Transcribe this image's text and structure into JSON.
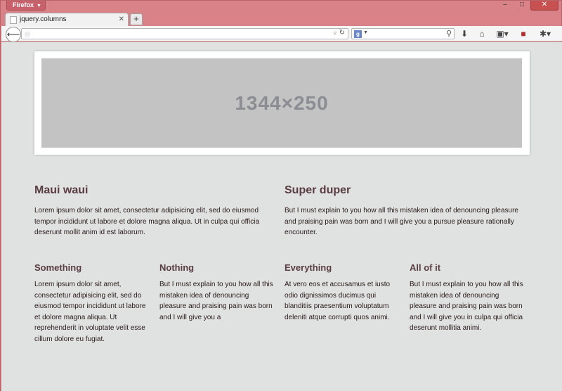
{
  "browser": {
    "app_button": "Firefox",
    "tab_title": "jquery.columns",
    "new_tab_label": "+",
    "url_value": "",
    "search_value": "",
    "controls": {
      "minimize": "–",
      "maximize": "□",
      "close": "✕"
    }
  },
  "banner": {
    "label": "1344×250"
  },
  "row1": [
    {
      "heading": "Maui waui",
      "text": "Lorem ipsum dolor sit amet, consectetur adipisicing elit, sed do eiusmod tempor incididunt ut labore et dolore magna aliqua. Ut in culpa qui officia deserunt mollit anim id est laborum."
    },
    {
      "heading": "Super duper",
      "text": "But I must explain to you how all this mistaken idea of denouncing pleasure and praising pain was born and I will give you a pursue pleasure rationally encounter."
    }
  ],
  "row2": [
    {
      "heading": "Something",
      "text": "Lorem ipsum dolor sit amet, consectetur adipisicing elit, sed do eiusmod tempor incididunt ut labore et dolore magna aliqua. Ut reprehenderit in voluptate velit esse cillum dolore eu fugiat."
    },
    {
      "heading": "Nothing",
      "text": "But I must explain to you how all this mistaken idea of denouncing pleasure and praising pain was born and I will give you a"
    },
    {
      "heading": "Everything",
      "text": "At vero eos et accusamus et iusto odio dignissimos ducimus qui blanditiis praesentium voluptatum deleniti atque corrupti quos animi."
    },
    {
      "heading": "All of it",
      "text": "But I must explain to you how all this mistaken idea of denouncing pleasure and praising pain was born and I will give you in culpa qui officia deserunt mollitia animi."
    }
  ]
}
